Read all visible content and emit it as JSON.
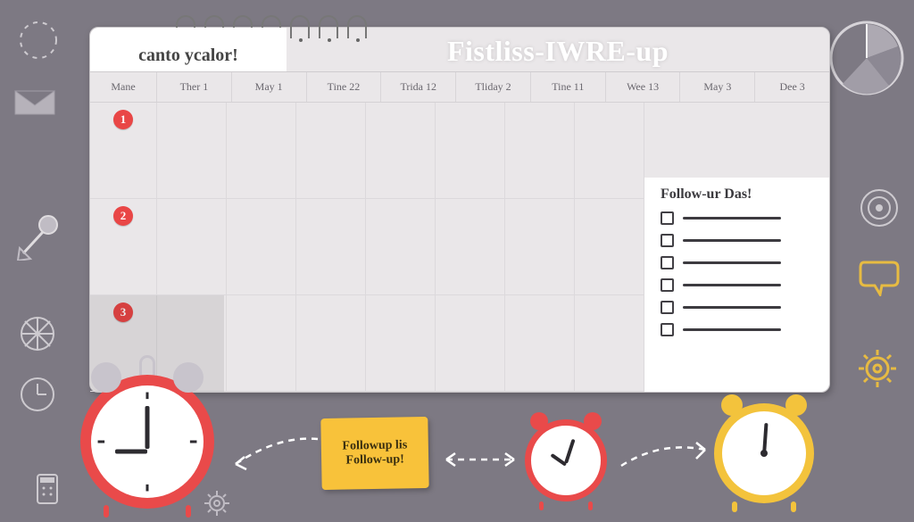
{
  "titles": {
    "left": "canto ycalor!",
    "main": "Fistliss-IWRE-up"
  },
  "headers": [
    "Mane",
    "Ther 1",
    "May 1",
    "Tine 22",
    "Trida 12",
    "Tliday 2",
    "Tine 11",
    "Wee 13",
    "May 3",
    "Dee 3"
  ],
  "row_numbers": [
    "1",
    "2",
    "3"
  ],
  "followup": {
    "title": "Follow-ur Das!",
    "item_count": 6
  },
  "sticky": {
    "line1": "Followup lis",
    "line2": "Follow-up!"
  }
}
